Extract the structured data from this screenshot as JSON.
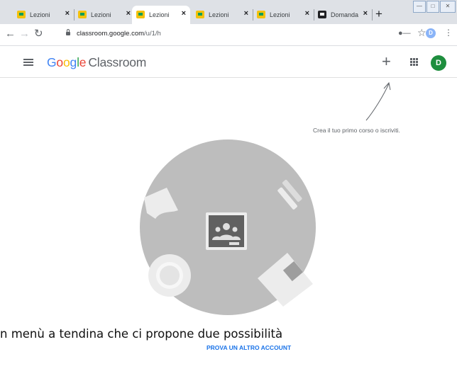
{
  "browser": {
    "tabs": [
      {
        "label": "Lezioni",
        "active": false,
        "favicon": "classroom-favicon"
      },
      {
        "label": "Lezioni",
        "active": false,
        "favicon": "classroom-favicon"
      },
      {
        "label": "Lezioni",
        "active": true,
        "favicon": "classroom-favicon"
      },
      {
        "label": "Lezioni",
        "active": false,
        "favicon": "classroom-favicon"
      },
      {
        "label": "Lezioni",
        "active": false,
        "favicon": "classroom-favicon"
      },
      {
        "label": "Domanda",
        "active": false,
        "favicon": "form-favicon"
      }
    ],
    "tab_close": "×",
    "new_tab": "+",
    "url_host": "classroom.google.com",
    "url_path": "/u/1/h",
    "profile_initial": "D"
  },
  "app": {
    "logo": {
      "g1": "G",
      "g2": "o",
      "g3": "o",
      "g4": "g",
      "g5": "l",
      "g6": "e",
      "word": "Classroom"
    },
    "add_button": "+",
    "avatar_initial": "D",
    "accent_color": "#1e8e3e"
  },
  "empty_state": {
    "hint": "Crea il tuo primo corso o iscriviti."
  },
  "overlay": {
    "document_text": "n menù a tendina che ci propone due possibilità",
    "switch_account": "PROVA UN ALTRO ACCOUNT"
  }
}
